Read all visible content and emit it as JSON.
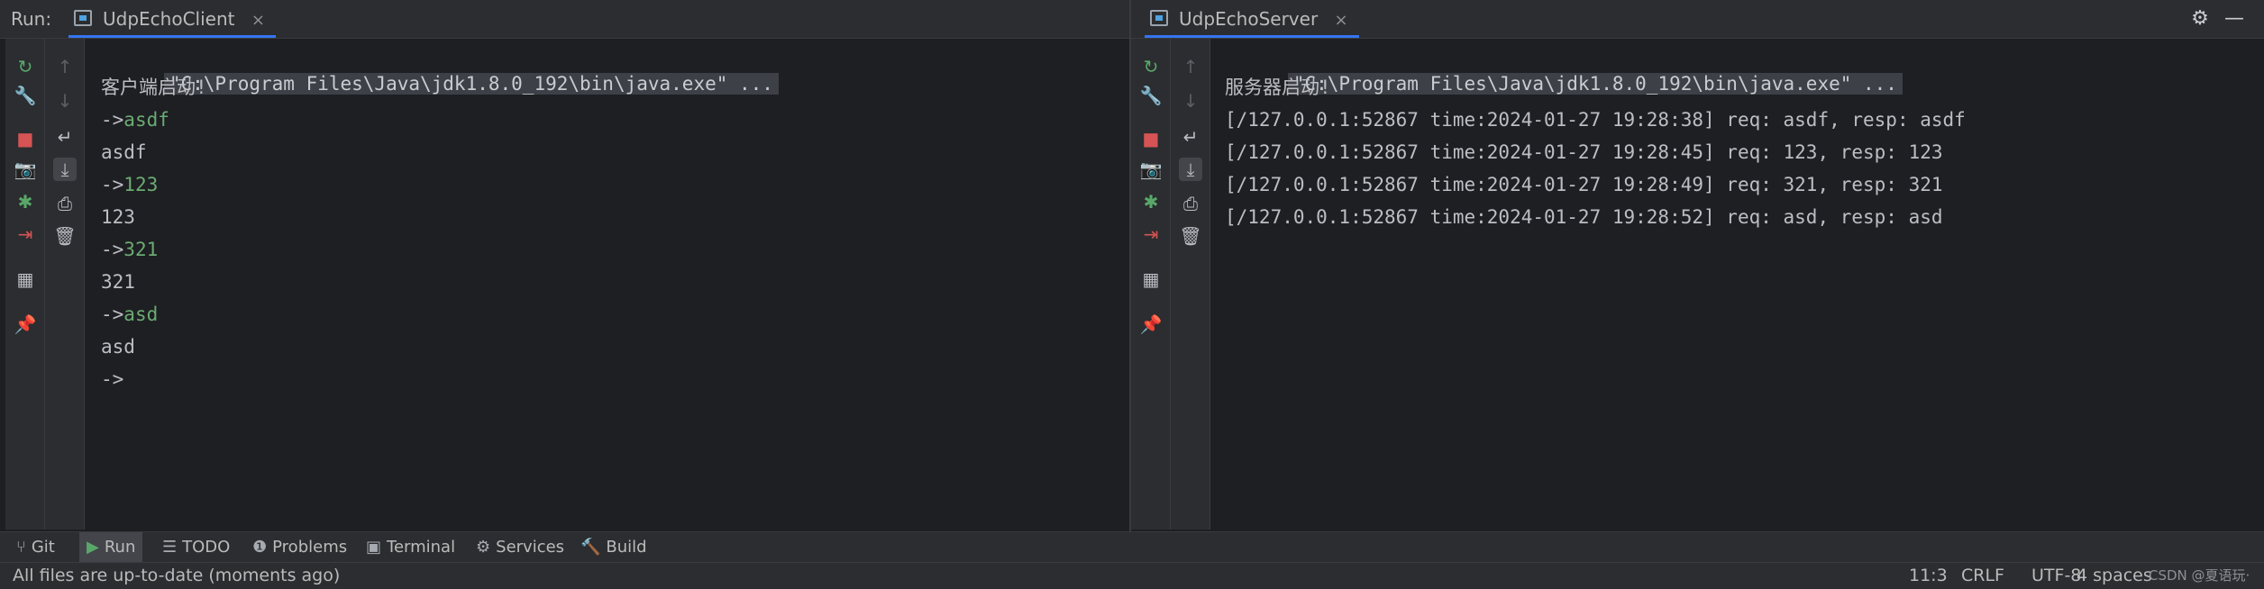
{
  "run_tab_label": "Run:",
  "tabs": [
    {
      "label": "UdpEchoClient",
      "close": "×"
    },
    {
      "label": "UdpEchoServer",
      "close": "×"
    }
  ],
  "icons": {
    "settings": "gear-icon",
    "minimize": "minimize-icon"
  },
  "client_console": {
    "command": "\"C:\\Program Files\\Java\\jdk1.8.0_192\\bin\\java.exe\" ...",
    "lines": [
      {
        "prompt": "",
        "text": "客户端启动!",
        "kind": "out"
      },
      {
        "prompt": "->",
        "text": "asdf",
        "kind": "input"
      },
      {
        "prompt": "",
        "text": "asdf",
        "kind": "out"
      },
      {
        "prompt": "->",
        "text": "123",
        "kind": "input"
      },
      {
        "prompt": "",
        "text": "123",
        "kind": "out"
      },
      {
        "prompt": "->",
        "text": "321",
        "kind": "input"
      },
      {
        "prompt": "",
        "text": "321",
        "kind": "out"
      },
      {
        "prompt": "->",
        "text": "asd",
        "kind": "input"
      },
      {
        "prompt": "",
        "text": "asd",
        "kind": "out"
      },
      {
        "prompt": "->",
        "text": "",
        "kind": "input"
      }
    ]
  },
  "server_console": {
    "command": "\"C:\\Program Files\\Java\\jdk1.8.0_192\\bin\\java.exe\" ...",
    "lines": [
      {
        "prompt": "",
        "text": "服务器启动!",
        "kind": "out"
      },
      {
        "prompt": "",
        "text": "[/127.0.0.1:52867 time:2024-01-27 19:28:38] req: asdf, resp: asdf",
        "kind": "out"
      },
      {
        "prompt": "",
        "text": "[/127.0.0.1:52867 time:2024-01-27 19:28:45] req: 123, resp: 123",
        "kind": "out"
      },
      {
        "prompt": "",
        "text": "[/127.0.0.1:52867 time:2024-01-27 19:28:49] req: 321, resp: 321",
        "kind": "out"
      },
      {
        "prompt": "",
        "text": "[/127.0.0.1:52867 time:2024-01-27 19:28:52] req: asd, resp: asd",
        "kind": "out"
      }
    ]
  },
  "side_tools": [
    {
      "name": "rerun-icon",
      "glyph": "↻"
    },
    {
      "name": "wrench-icon",
      "glyph": "🔧"
    },
    {
      "name": "stop-icon",
      "glyph": "■"
    },
    {
      "name": "camera-icon",
      "glyph": "📷"
    },
    {
      "name": "debug-icon",
      "glyph": "✱"
    },
    {
      "name": "exit-icon",
      "glyph": "⇥"
    },
    {
      "name": "layout-icon",
      "glyph": "▦"
    },
    {
      "name": "pin-icon",
      "glyph": "📌"
    }
  ],
  "scroll_tools": [
    {
      "name": "up-arrow-icon",
      "glyph": "↑"
    },
    {
      "name": "down-arrow-icon",
      "glyph": "↓"
    },
    {
      "name": "soft-wrap-icon",
      "glyph": "↵"
    },
    {
      "name": "scroll-to-end-icon",
      "glyph": "⤓"
    },
    {
      "name": "print-icon",
      "glyph": "⎙"
    },
    {
      "name": "trash-icon",
      "glyph": "🗑"
    }
  ],
  "bottom_tools": [
    {
      "label": "Git",
      "icon": "git-branch-icon",
      "glyph": "⑂"
    },
    {
      "label": "Run",
      "icon": "run-icon",
      "glyph": "▶"
    },
    {
      "label": "TODO",
      "icon": "todo-list-icon",
      "glyph": "☰"
    },
    {
      "label": "Problems",
      "icon": "problems-icon",
      "glyph": "❶"
    },
    {
      "label": "Terminal",
      "icon": "terminal-icon",
      "glyph": "▣"
    },
    {
      "label": "Services",
      "icon": "services-icon",
      "glyph": "⚙"
    },
    {
      "label": "Build",
      "icon": "build-hammer-icon",
      "glyph": "🔨"
    }
  ],
  "status": {
    "message": "All files are up-to-date (moments ago)",
    "position": "11:3",
    "line_separator": "CRLF",
    "encoding": "UTF-8",
    "indent": "4 spaces",
    "watermark": "CSDN @夏语玩·"
  },
  "colors": {
    "background": "#1e1f22",
    "panel": "#2b2d30",
    "input_text": "#6aab73",
    "accent": "#3574f0",
    "stop": "#d65454",
    "rerun": "#59a869"
  }
}
